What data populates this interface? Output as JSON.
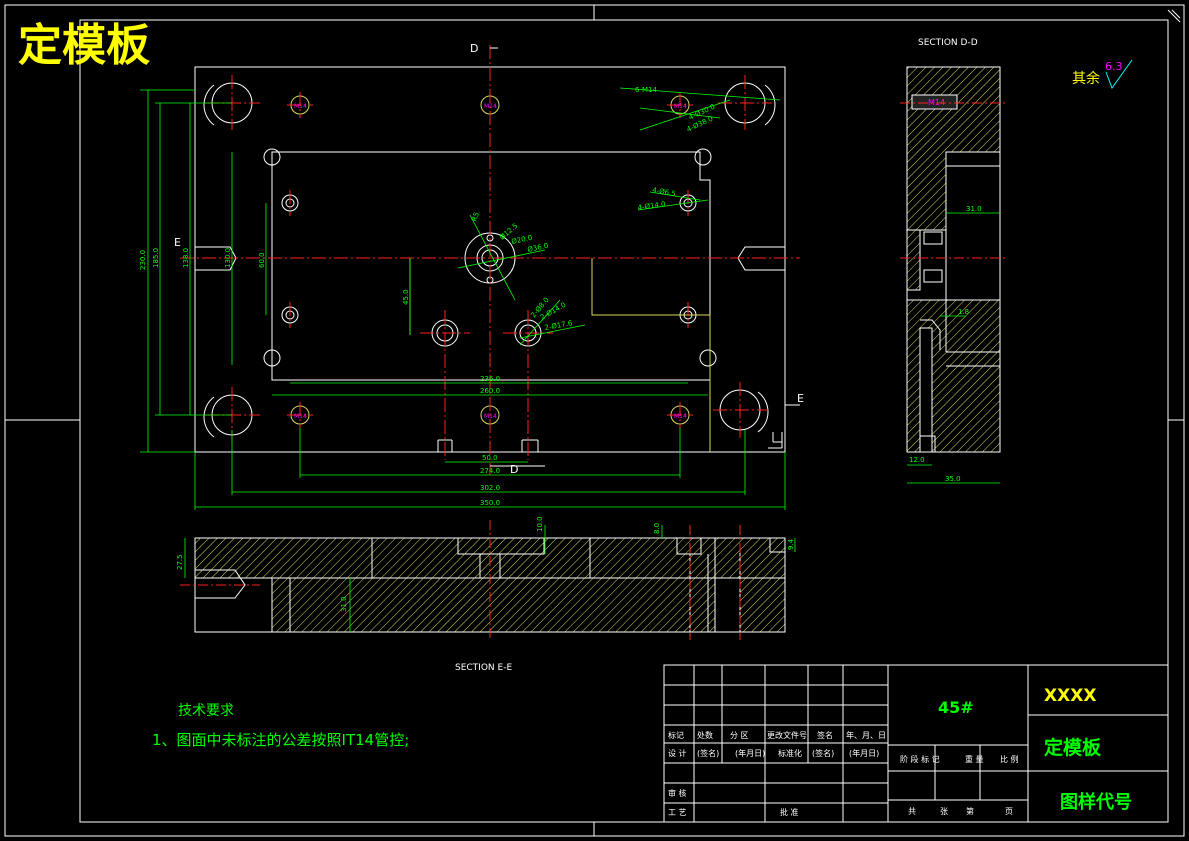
{
  "title": "定模板",
  "section_dd": {
    "label": "SECTION D-D",
    "dims": [
      "31.0",
      "1.8",
      "12.0",
      "35.0"
    ],
    "thread": "M14"
  },
  "section_ee": {
    "label": "SECTION E-E",
    "dims": [
      "27.5",
      "31.0",
      "10.0",
      "8.0",
      "9.4"
    ]
  },
  "view_markers": {
    "d_top": "D",
    "d_bottom": "D",
    "e_left": "E",
    "e_right": "E"
  },
  "roughness": {
    "prefix": "其余",
    "value": "6.3"
  },
  "plan": {
    "vertical_dims": [
      "230.0",
      "185.0",
      "138.0",
      "130.0",
      "60.0",
      "45.0"
    ],
    "horizontal_dims": [
      "236.0",
      "260.0",
      "50.0",
      "274.0",
      "302.0",
      "350.0"
    ],
    "hole_labels": [
      "M14",
      "M14",
      "M14",
      "M14",
      "M14",
      "M14",
      "M14"
    ],
    "callouts": [
      "6-M14",
      "4-Ø30.0",
      "4-Ø38.0",
      "4-Ø6.5",
      "4-Ø14.0",
      "Ø12.5",
      "Ø20.0",
      "Ø36.0",
      "2-Ø8.0",
      "2-Ø14.0",
      "2-Ø17.6",
      "R5"
    ]
  },
  "tech_req": {
    "heading": "技术要求",
    "line1": "1、图面中未标注的公差按照IT14管控;"
  },
  "title_block": {
    "material": "45#",
    "company": "XXXX",
    "part_name": "定模板",
    "drawing_no": "图样代号",
    "row_labels": [
      "标记",
      "处数",
      "分 区",
      "更改文件号",
      "签名",
      "年、月、日"
    ],
    "design_row": [
      "设 计",
      "(签名)",
      "(年月日)",
      "标准化",
      "(签名)",
      "(年月日)"
    ],
    "stage_row": [
      "阶 段 标 记",
      "重 量",
      "比 例"
    ],
    "review": "审 核",
    "process": "工 艺",
    "approve": "批 准",
    "sheets": [
      "共",
      "张",
      "第",
      "页"
    ]
  },
  "colors": {
    "line": "#ffffff",
    "dim": "#00ff00",
    "center": "#ff2020",
    "hatch": "#ffff66",
    "hole": "#ff00ff",
    "title_text": "#ffff00"
  }
}
